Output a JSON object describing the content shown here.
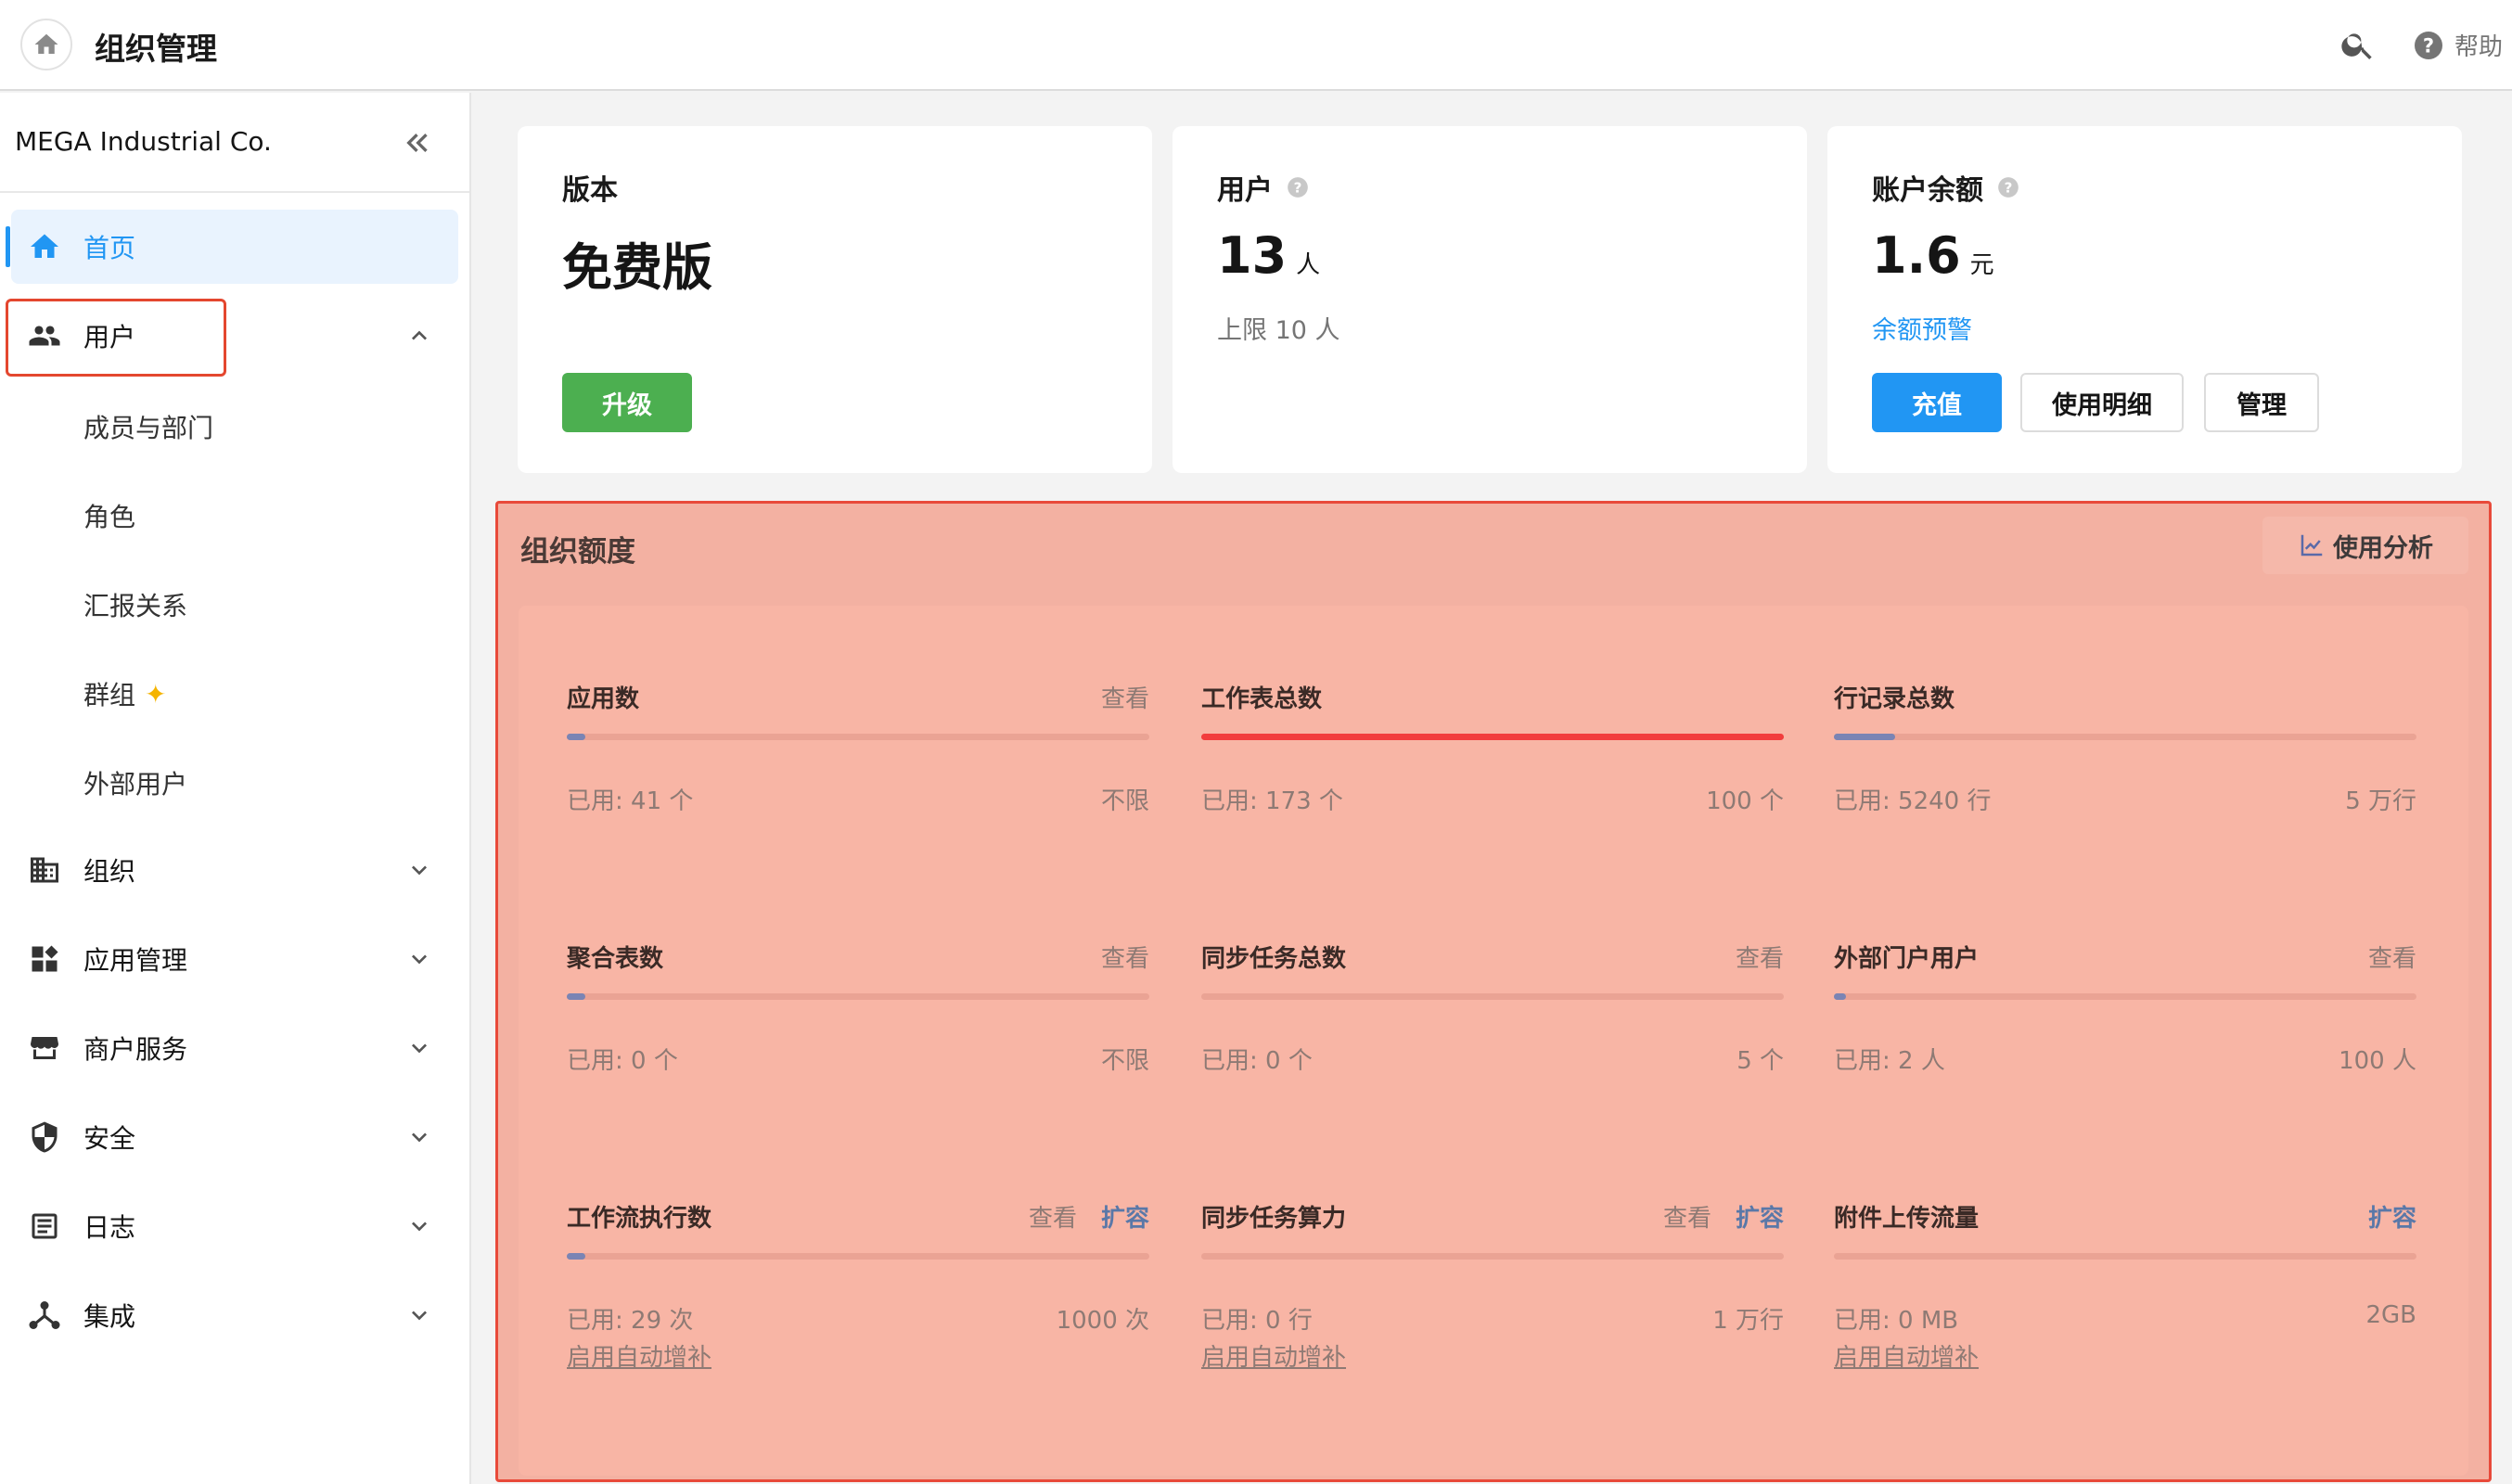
{
  "header": {
    "title": "组织管理",
    "help_label": "帮助"
  },
  "sidebar": {
    "org_name": "MEGA Industrial Co.",
    "items": [
      {
        "label": "首页",
        "icon": "home-icon",
        "active": true
      },
      {
        "label": "用户",
        "icon": "users-icon",
        "expanded": true
      },
      {
        "label": "组织",
        "icon": "building-icon"
      },
      {
        "label": "应用管理",
        "icon": "apps-icon"
      },
      {
        "label": "商户服务",
        "icon": "store-icon"
      },
      {
        "label": "安全",
        "icon": "shield-icon"
      },
      {
        "label": "日志",
        "icon": "log-icon"
      },
      {
        "label": "集成",
        "icon": "integration-icon"
      }
    ],
    "user_subitems": [
      "成员与部门",
      "角色",
      "汇报关系",
      "群组",
      "外部用户"
    ]
  },
  "cards": {
    "edition": {
      "title": "版本",
      "value": "免费版",
      "button": "升级"
    },
    "users": {
      "title": "用户",
      "value": "13",
      "unit": "人",
      "sub": "上限 10 人"
    },
    "balance": {
      "title": "账户余额",
      "value": "1.6",
      "unit": "元",
      "link": "余额预警",
      "buttons": [
        "充值",
        "使用明细",
        "管理"
      ]
    }
  },
  "quota": {
    "title": "组织额度",
    "analysis_button": "使用分析",
    "metrics": [
      {
        "label": "应用数",
        "view": "查看",
        "used": "已用: 41 个",
        "limit": "不限",
        "ratio": 0
      },
      {
        "label": "工作表总数",
        "used": "已用: 173 个",
        "limit": "100 个",
        "ratio": 1,
        "over": true
      },
      {
        "label": "行记录总数",
        "used": "已用: 5240 行",
        "limit": "5 万行",
        "ratio": 0.1048
      },
      {
        "label": "聚合表数",
        "view": "查看",
        "used": "已用: 0 个",
        "limit": "不限",
        "ratio": 0
      },
      {
        "label": "同步任务总数",
        "view": "查看",
        "used": "已用: 0 个",
        "limit": "5 个",
        "ratio": 0
      },
      {
        "label": "外部门户用户",
        "view": "查看",
        "used": "已用: 2 人",
        "limit": "100 人",
        "ratio": 0.02
      },
      {
        "label": "工作流执行数",
        "view": "查看",
        "expand": "扩容",
        "used": "已用: 29 次",
        "limit": "1000 次",
        "ratio": 0.029,
        "auto": "启用自动增补"
      },
      {
        "label": "同步任务算力",
        "view": "查看",
        "expand": "扩容",
        "used": "已用: 0 行",
        "limit": "1 万行",
        "ratio": 0,
        "auto": "启用自动增补"
      },
      {
        "label": "附件上传流量",
        "expand": "扩容",
        "used": "已用: 0 MB",
        "limit": "2GB",
        "ratio": 0,
        "auto": "启用自动增补"
      }
    ]
  },
  "colors": {
    "accent": "#2196f3",
    "upgrade": "#4caf50",
    "over": "#f23d3d"
  }
}
